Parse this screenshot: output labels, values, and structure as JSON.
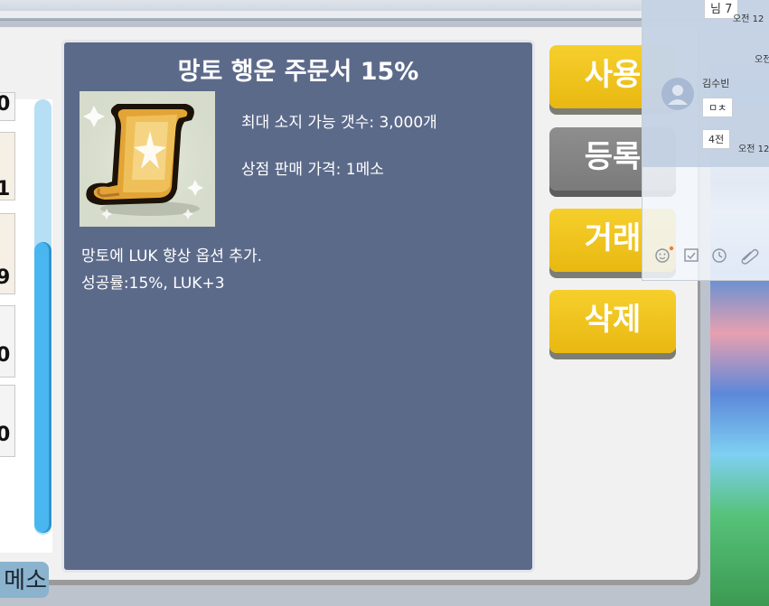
{
  "item": {
    "title": "망토 행운 주문서 15%",
    "icon": "scroll-icon",
    "max_count": "최대 소지 가능 갯수: 3,000개",
    "shop_price": "상점 판매 가격: 1메소",
    "description_line1": "망토에 LUK 향상 옵션 추가.",
    "description_line2": "성공률:15%, LUK+3"
  },
  "buttons": {
    "use": "사용",
    "register": "등록",
    "trade": "거래",
    "delete": "삭제"
  },
  "inventory": {
    "counts": [
      "0",
      "1",
      "9",
      "0",
      "0"
    ],
    "meso_label": "메소"
  },
  "chat_overlay": {
    "top_text": "님 7",
    "time1": "오전 12",
    "time2": "오전",
    "sender": "김수빈",
    "bubble1": "ㅁㅊ",
    "bubble2": "4전",
    "time3": "오전 12",
    "icons": [
      "emoji-icon",
      "calendar-icon",
      "clock-icon",
      "attachment-icon"
    ]
  },
  "colors": {
    "detail_panel": "#5c6a8a",
    "button_yellow": "#f0c21c",
    "button_gray": "#858585",
    "scrollbar": "#49b6f0"
  }
}
